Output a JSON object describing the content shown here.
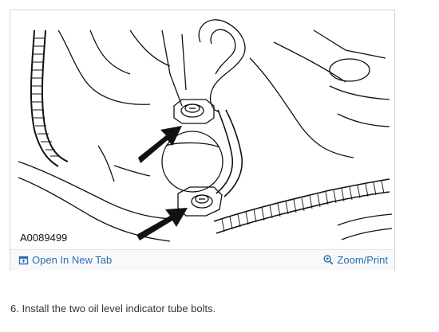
{
  "figure": {
    "id_label": "A0089499",
    "open_label": "Open In New Tab",
    "zoom_label": "Zoom/Print",
    "icons": {
      "open": "open-in-new-tab-icon",
      "zoom": "zoom-magnifier-icon"
    }
  },
  "step": {
    "text": "6. Install the two oil level indicator tube bolts."
  }
}
